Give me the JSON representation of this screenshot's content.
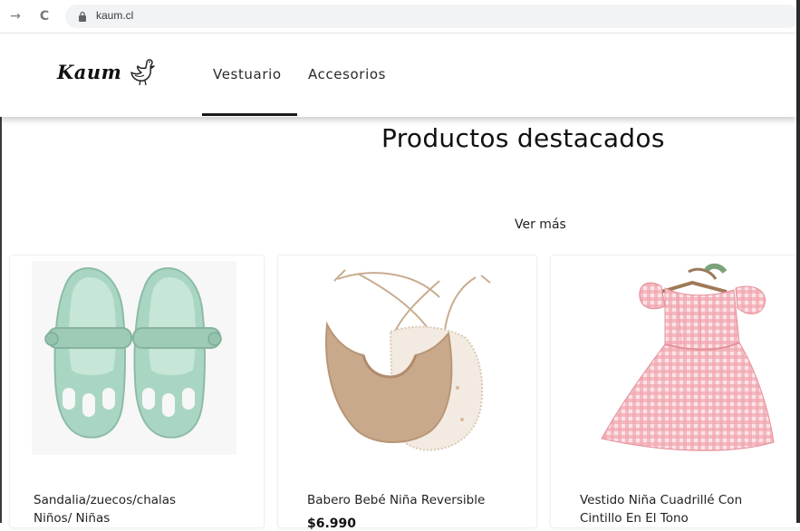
{
  "browser": {
    "back_icon": "arrow-right-icon",
    "back_glyph": "→",
    "reload_glyph": "C",
    "url": "kaum.cl"
  },
  "header": {
    "logo_text": "Kaum",
    "nav": [
      {
        "label": "Vestuario",
        "active": true
      },
      {
        "label": "Accesorios",
        "active": false
      }
    ]
  },
  "main": {
    "title": "Productos destacados",
    "see_more": "Ver más",
    "products": [
      {
        "name_line1": "Sandalia/zuecos/chalas",
        "name_line2": "Niños/ Niñas",
        "price": ""
      },
      {
        "name_line1": "Babero Bebé Niña Reversible",
        "name_line2": "",
        "price": "$6.990"
      },
      {
        "name_line1": "Vestido Niña Cuadrillé Con",
        "name_line2": "Cintillo En El Tono",
        "price": ""
      }
    ]
  },
  "colors": {
    "accent": "#1a1a1a",
    "shoe": "#a9d6c2",
    "bib_front": "#c9a98c",
    "dress": "#f2a7b0"
  }
}
